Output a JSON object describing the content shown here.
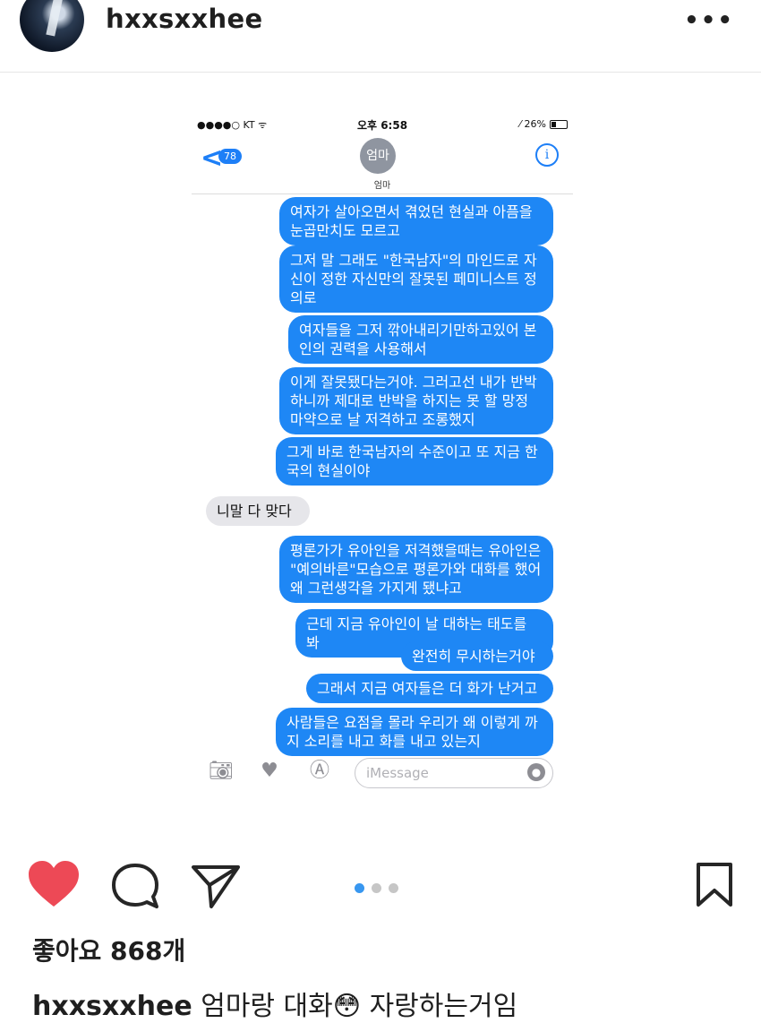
{
  "header": {
    "username": "hxxsxxhee",
    "more_label": "•••"
  },
  "screenshot": {
    "status": {
      "carrier": "●●●●○ KT ᯤ",
      "time": "오후 6:58",
      "battery": "⁄ 26%"
    },
    "nav": {
      "back_chevron": "<",
      "back_count": "78",
      "contact_avatar": "엄마",
      "contact_name": "엄마",
      "info": "i"
    },
    "messages": [
      {
        "dir": "out",
        "text": "여자가 살아오면서 겪었던 현실과 아픔을 눈곱만치도 모르고"
      },
      {
        "dir": "out",
        "text": "그저 말 그래도 \"한국남자\"의 마인드로 자신이 정한 자신만의 잘못된 페미니스트 정의로"
      },
      {
        "dir": "out",
        "text": "여자들을 그저 깎아내리기만하고있어 본인의 권력을 사용해서"
      },
      {
        "dir": "out",
        "text": "이게 잘못됐다는거야. 그러고선 내가 반박하니까 제대로 반박을 하지는 못 할 망정 마약으로 날 저격하고 조롱했지"
      },
      {
        "dir": "out",
        "text": "그게 바로 한국남자의 수준이고 또 지금 한국의 현실이야"
      },
      {
        "dir": "in",
        "text": "니말 다 맞다"
      },
      {
        "dir": "out",
        "text": "평론가가 유아인을 저격했을때는 유아인은 \"예의바른\"모습으로 평론가와 대화를 했어 왜 그런생각을 가지게 됐냐고"
      },
      {
        "dir": "out",
        "text": "근데 지금 유아인이 날 대하는 태도를 봐"
      },
      {
        "dir": "out",
        "text": "완전히 무시하는거야"
      },
      {
        "dir": "out",
        "text": "그래서 지금 여자들은 더 화가 난거고"
      },
      {
        "dir": "out",
        "text": "사람들은 요점을 몰라 우리가 왜 이렇게 까지 소리를 내고 화를 내고 있는지"
      }
    ],
    "composer": {
      "placeholder": "iMessage"
    }
  },
  "actions": {
    "page_count": 3,
    "active_page": 1
  },
  "likes_text": "좋아요 868개",
  "caption": {
    "username": "hxxsxxhee",
    "text": "엄마랑 대화😳 자랑하는거임"
  },
  "colors": {
    "like_heart": "#ed4956",
    "imessage_blue": "#1e87f5",
    "pager_active": "#3897f0"
  }
}
